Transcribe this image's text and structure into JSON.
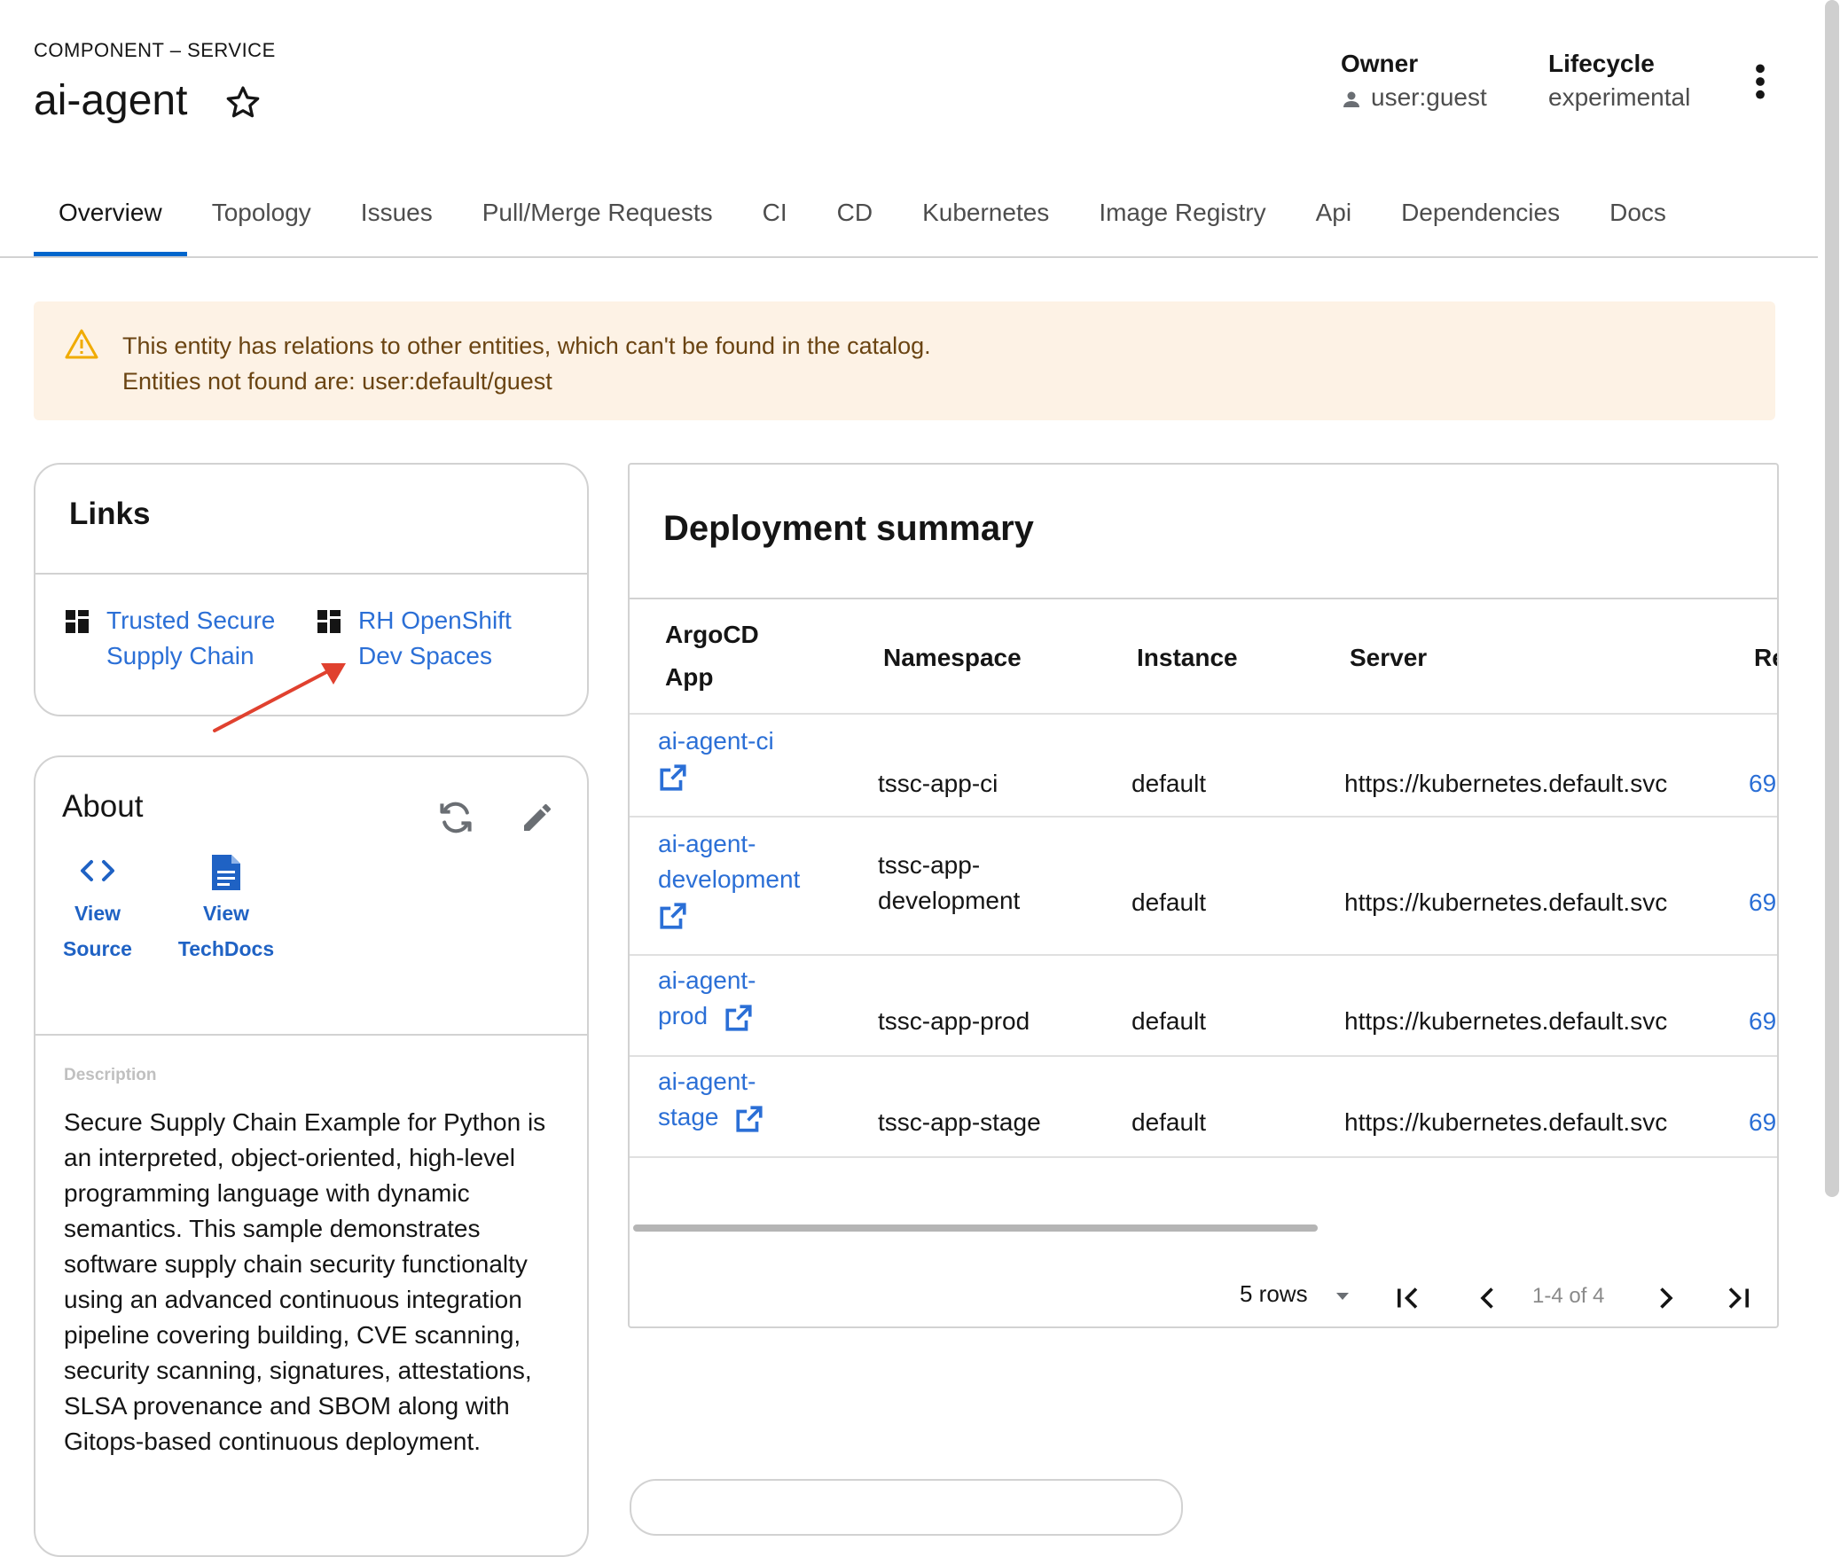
{
  "header": {
    "kind": "COMPONENT – SERVICE",
    "title": "ai-agent",
    "owner_label": "Owner",
    "owner_value": "user:guest",
    "lifecycle_label": "Lifecycle",
    "lifecycle_value": "experimental"
  },
  "tabs": [
    {
      "label": "Overview",
      "active": true
    },
    {
      "label": "Topology"
    },
    {
      "label": "Issues"
    },
    {
      "label": "Pull/Merge Requests"
    },
    {
      "label": "CI"
    },
    {
      "label": "CD"
    },
    {
      "label": "Kubernetes"
    },
    {
      "label": "Image Registry"
    },
    {
      "label": "Api"
    },
    {
      "label": "Dependencies"
    },
    {
      "label": "Docs"
    }
  ],
  "alert": {
    "line1": "This entity has relations to other entities, which can't be found in the catalog.",
    "line2": "Entities not found are: user:default/guest"
  },
  "links_card": {
    "title": "Links",
    "items": [
      {
        "line1": "Trusted Secure",
        "line2": "Supply Chain"
      },
      {
        "line1": "RH OpenShift",
        "line2": "Dev Spaces"
      }
    ]
  },
  "about_card": {
    "title": "About",
    "view_source": {
      "line1": "View",
      "line2": "Source"
    },
    "view_techdocs": {
      "line1": "View",
      "line2": "TechDocs"
    },
    "description_label": "Description",
    "description_lines": [
      "Secure Supply Chain Example for Python is",
      "an interpreted, object-oriented, high-level",
      "programming language with dynamic",
      "semantics. This sample demonstrates",
      "software supply chain security functionalty",
      "using an advanced continuous integration",
      "pipeline covering building, CVE scanning,",
      "security scanning, signatures, attestations,",
      "SLSA provenance and SBOM along with",
      "Gitops-based continuous deployment."
    ]
  },
  "deployment": {
    "title": "Deployment summary",
    "columns": {
      "app_line1": "ArgoCD",
      "app_line2": "App",
      "namespace": "Namespace",
      "instance": "Instance",
      "server": "Server",
      "revision": "Re"
    },
    "rows": [
      {
        "app_line1": "ai-agent-ci",
        "app_line2": "",
        "ns_line1": "tssc-app-ci",
        "ns_line2": "",
        "instance": "default",
        "server": "https://kubernetes.default.svc",
        "revision": "69"
      },
      {
        "app_line1": "ai-agent-",
        "app_line2": "development",
        "ns_line1": "tssc-app-",
        "ns_line2": "development",
        "instance": "default",
        "server": "https://kubernetes.default.svc",
        "revision": "69"
      },
      {
        "app_line1": "ai-agent-",
        "app_line2": "prod",
        "ns_line1": "tssc-app-prod",
        "ns_line2": "",
        "instance": "default",
        "server": "https://kubernetes.default.svc",
        "revision": "69"
      },
      {
        "app_line1": "ai-agent-",
        "app_line2": "stage",
        "ns_line1": "tssc-app-stage",
        "ns_line2": "",
        "instance": "default",
        "server": "https://kubernetes.default.svc",
        "revision": "69"
      }
    ],
    "pagination": {
      "rows_label": "5 rows",
      "range": "1-4 of 4"
    }
  },
  "colors": {
    "accent": "#0066cc",
    "link": "#2b6fd6",
    "alert_bg": "#fdf2e5",
    "alert_icon": "#f0ab00",
    "annotation_arrow": "#e0412f"
  },
  "icons": [
    "star-icon",
    "user-icon",
    "kebab-icon",
    "warning-icon",
    "grid-icon",
    "code-icon",
    "document-icon",
    "refresh-icon",
    "edit-icon",
    "external-link-icon",
    "caret-down-icon",
    "first-page-icon",
    "prev-page-icon",
    "next-page-icon",
    "last-page-icon"
  ]
}
